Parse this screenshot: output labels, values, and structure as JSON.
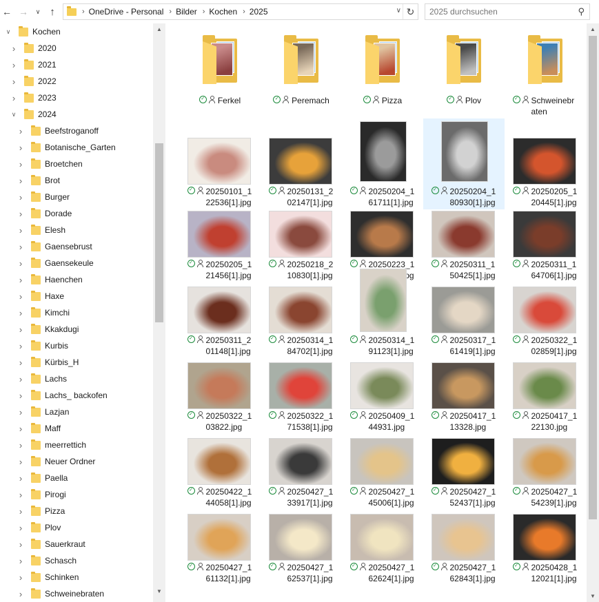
{
  "nav": {
    "back_icon": "arrow-left-icon",
    "forward_icon": "arrow-right-icon",
    "history_icon": "chevron-down-icon",
    "up_icon": "arrow-up-icon",
    "back_glyph": "←",
    "forward_glyph": "→",
    "history_glyph": "∨",
    "up_glyph": "↑"
  },
  "address": {
    "crumbs": [
      "OneDrive - Personal",
      "Bilder",
      "Kochen",
      "2025"
    ],
    "sep_glyph": "›",
    "dropdown_glyph": "∨",
    "refresh_glyph": "↻"
  },
  "search": {
    "placeholder": "2025 durchsuchen",
    "icon_glyph": "⚲"
  },
  "tree": {
    "items": [
      {
        "label": "Kochen",
        "level": 0,
        "expanded": true
      },
      {
        "label": "2020",
        "level": 1,
        "expanded": false
      },
      {
        "label": "2021",
        "level": 1,
        "expanded": false
      },
      {
        "label": "2022",
        "level": 1,
        "expanded": false
      },
      {
        "label": "2023",
        "level": 1,
        "expanded": false
      },
      {
        "label": "2024",
        "level": 1,
        "expanded": true
      },
      {
        "label": "Beefstroganoff",
        "level": 2,
        "expanded": false
      },
      {
        "label": "Botanische_Garten",
        "level": 2,
        "expanded": false
      },
      {
        "label": "Broetchen",
        "level": 2,
        "expanded": false
      },
      {
        "label": "Brot",
        "level": 2,
        "expanded": false
      },
      {
        "label": "Burger",
        "level": 2,
        "expanded": false
      },
      {
        "label": "Dorade",
        "level": 2,
        "expanded": false
      },
      {
        "label": "Elesh",
        "level": 2,
        "expanded": false
      },
      {
        "label": "Gaensebrust",
        "level": 2,
        "expanded": false
      },
      {
        "label": "Gaensekeule",
        "level": 2,
        "expanded": false
      },
      {
        "label": "Haenchen",
        "level": 2,
        "expanded": false
      },
      {
        "label": "Haxe",
        "level": 2,
        "expanded": false
      },
      {
        "label": "Kimchi",
        "level": 2,
        "expanded": false
      },
      {
        "label": "Kkakdugi",
        "level": 2,
        "expanded": false
      },
      {
        "label": "Kurbis",
        "level": 2,
        "expanded": false
      },
      {
        "label": "Kürbis_H",
        "level": 2,
        "expanded": false
      },
      {
        "label": "Lachs",
        "level": 2,
        "expanded": false
      },
      {
        "label": "Lachs_ backofen",
        "level": 2,
        "expanded": false
      },
      {
        "label": "Lazjan",
        "level": 2,
        "expanded": false
      },
      {
        "label": "Maff",
        "level": 2,
        "expanded": false
      },
      {
        "label": "meerrettich",
        "level": 2,
        "expanded": false
      },
      {
        "label": "Neuer Ordner",
        "level": 2,
        "expanded": false
      },
      {
        "label": "Paella",
        "level": 2,
        "expanded": false
      },
      {
        "label": "Pirogi",
        "level": 2,
        "expanded": false
      },
      {
        "label": "Pizza",
        "level": 2,
        "expanded": false
      },
      {
        "label": "Plov",
        "level": 2,
        "expanded": false
      },
      {
        "label": "Sauerkraut",
        "level": 2,
        "expanded": false
      },
      {
        "label": "Schasch",
        "level": 2,
        "expanded": false
      },
      {
        "label": "Schinken",
        "level": 2,
        "expanded": false
      },
      {
        "label": "Schweinebraten",
        "level": 2,
        "expanded": false
      }
    ]
  },
  "folders": [
    {
      "name": "Ferkel",
      "thumb_colors": [
        "#c98b8b",
        "#8a3f3f"
      ]
    },
    {
      "name": "Peremach",
      "thumb_colors": [
        "#7a6a5a",
        "#e7d4b8"
      ]
    },
    {
      "name": "Pizza",
      "thumb_colors": [
        "#e0c4a0",
        "#b7472f"
      ]
    },
    {
      "name": "Plov",
      "thumb_colors": [
        "#4a4a4a",
        "#c0c0c0"
      ]
    },
    {
      "name": "Schweinebraten",
      "thumb_colors": [
        "#3e7fb4",
        "#c88e5a"
      ]
    }
  ],
  "files": [
    {
      "name": "20250101_122536[1].jpg",
      "orient": "land",
      "colors": [
        "#f1ece5",
        "#c98b7f"
      ],
      "selected": false
    },
    {
      "name": "20250131_202147[1].jpg",
      "orient": "land",
      "colors": [
        "#3c3c3c",
        "#e7a23a"
      ],
      "selected": false
    },
    {
      "name": "20250204_161711[1].jpg",
      "orient": "port",
      "colors": [
        "#2a2a2a",
        "#9b9b9b"
      ],
      "selected": false
    },
    {
      "name": "20250204_180930[1].jpg",
      "orient": "port",
      "colors": [
        "#6b6b6b",
        "#d2d2d2"
      ],
      "selected": true
    },
    {
      "name": "20250205_120445[1].jpg",
      "orient": "land",
      "colors": [
        "#2c2c2c",
        "#d4552d"
      ],
      "selected": false
    },
    {
      "name": "20250205_121456[1].jpg",
      "orient": "land",
      "colors": [
        "#b8b3c6",
        "#c04030"
      ],
      "selected": false
    },
    {
      "name": "20250218_210830[1].jpg",
      "orient": "land",
      "colors": [
        "#f3dede",
        "#8a4a3e"
      ],
      "selected": false
    },
    {
      "name": "20250223_123225[1].jpg",
      "orient": "land",
      "colors": [
        "#2e2e2e",
        "#b87a4a"
      ],
      "selected": false
    },
    {
      "name": "20250311_150425[1].jpg",
      "orient": "land",
      "colors": [
        "#d0c6bd",
        "#8a3a2e"
      ],
      "selected": false
    },
    {
      "name": "20250311_164706[1].jpg",
      "orient": "land",
      "colors": [
        "#3a3a3a",
        "#7a3d2a"
      ],
      "selected": false
    },
    {
      "name": "20250311_201148[1].jpg",
      "orient": "land",
      "colors": [
        "#e6e2de",
        "#6b2e1e"
      ],
      "selected": false
    },
    {
      "name": "20250314_184702[1].jpg",
      "orient": "land",
      "colors": [
        "#e4ddd4",
        "#8a4530"
      ],
      "selected": false
    },
    {
      "name": "20250314_191123[1].jpg",
      "orient": "port",
      "colors": [
        "#d9d2c8",
        "#7aa06e"
      ],
      "selected": false
    },
    {
      "name": "20250317_161419[1].jpg",
      "orient": "land",
      "colors": [
        "#9b9b96",
        "#e4d7c5"
      ],
      "selected": false
    },
    {
      "name": "20250322_102859[1].jpg",
      "orient": "land",
      "colors": [
        "#d8d4d0",
        "#d94a3a"
      ],
      "selected": false
    },
    {
      "name": "20250322_103822.jpg",
      "orient": "land",
      "colors": [
        "#b0a48e",
        "#c57a5a"
      ],
      "selected": false
    },
    {
      "name": "20250322_171538[1].jpg",
      "orient": "land",
      "colors": [
        "#a8b0a8",
        "#e0443a"
      ],
      "selected": false
    },
    {
      "name": "20250409_144931.jpg",
      "orient": "land",
      "colors": [
        "#e8e4e0",
        "#7a8a5a"
      ],
      "selected": false
    },
    {
      "name": "20250417_113328.jpg",
      "orient": "land",
      "colors": [
        "#5a5048",
        "#c89860"
      ],
      "selected": false
    },
    {
      "name": "20250417_122130.jpg",
      "orient": "land",
      "colors": [
        "#d8d0c6",
        "#6a8a4a"
      ],
      "selected": false
    },
    {
      "name": "20250422_144058[1].jpg",
      "orient": "land",
      "colors": [
        "#e8e4de",
        "#b0703a"
      ],
      "selected": false
    },
    {
      "name": "20250427_133917[1].jpg",
      "orient": "land",
      "colors": [
        "#d8d4cf",
        "#3a3a3a"
      ],
      "selected": false
    },
    {
      "name": "20250427_145006[1].jpg",
      "orient": "land",
      "colors": [
        "#c8c4be",
        "#e4c48a"
      ],
      "selected": false
    },
    {
      "name": "20250427_152437[1].jpg",
      "orient": "land",
      "colors": [
        "#1e1e1e",
        "#f0b040"
      ],
      "selected": false
    },
    {
      "name": "20250427_154239[1].jpg",
      "orient": "land",
      "colors": [
        "#cfc8c0",
        "#d89a4a"
      ],
      "selected": false
    },
    {
      "name": "20250427_161132[1].jpg",
      "orient": "land",
      "colors": [
        "#d8cfc5",
        "#e0a458"
      ],
      "selected": false
    },
    {
      "name": "20250427_162537[1].jpg",
      "orient": "land",
      "colors": [
        "#b8b0a8",
        "#f4e8c8"
      ],
      "selected": false
    },
    {
      "name": "20250427_162624[1].jpg",
      "orient": "land",
      "colors": [
        "#c8bcb0",
        "#f0e4c0"
      ],
      "selected": false
    },
    {
      "name": "20250427_162843[1].jpg",
      "orient": "land",
      "colors": [
        "#cfc6bd",
        "#e8c490"
      ],
      "selected": false
    },
    {
      "name": "20250428_112021[1].jpg",
      "orient": "land",
      "colors": [
        "#2a2a2a",
        "#e87a2a"
      ],
      "selected": false
    }
  ],
  "colors": {
    "folder": "#f8d265",
    "sync_ok": "#1a8a3a",
    "selection": "#e5f3ff",
    "scrollbar_thumb": "#c2c2c2"
  },
  "scroll_glyphs": {
    "up": "▲",
    "down": "▼"
  }
}
